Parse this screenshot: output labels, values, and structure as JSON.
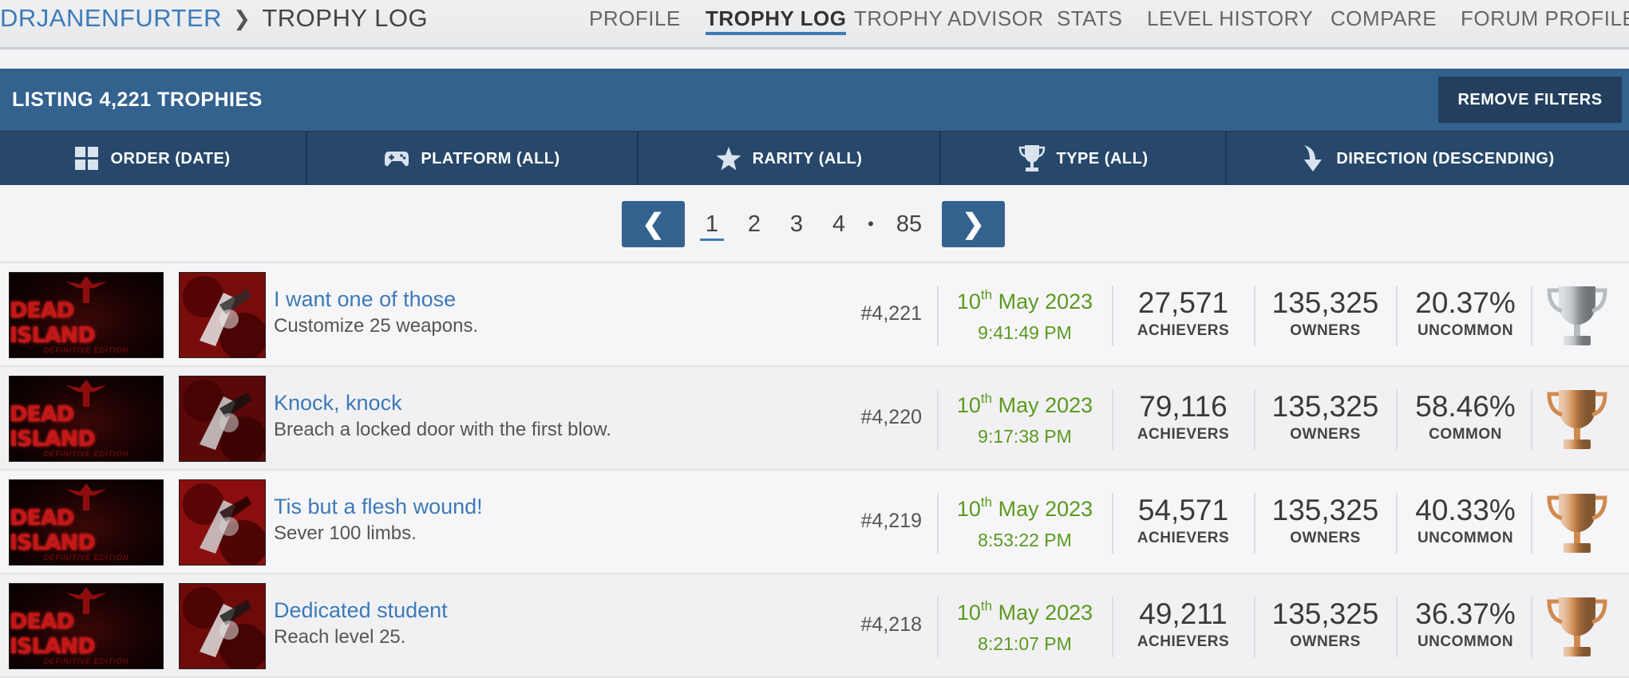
{
  "breadcrumb": {
    "user": "DRJANENFURTER",
    "separator": "❯",
    "page": "TROPHY LOG"
  },
  "nav": {
    "tabs": [
      {
        "label": "PROFILE",
        "active": false
      },
      {
        "label": "TROPHY LOG",
        "active": true
      },
      {
        "label": "TROPHY ADVISOR",
        "active": false
      },
      {
        "label": "STATS",
        "active": false
      },
      {
        "label": "LEVEL HISTORY",
        "active": false
      },
      {
        "label": "COMPARE",
        "active": false
      },
      {
        "label": "FORUM PROFILE",
        "active": false
      }
    ]
  },
  "listing": {
    "title": "LISTING 4,221 TROPHIES",
    "remove_filters": "REMOVE FILTERS"
  },
  "filters": [
    {
      "label": "ORDER (DATE)",
      "icon": "grid-icon"
    },
    {
      "label": "PLATFORM (ALL)",
      "icon": "gamepad-icon"
    },
    {
      "label": "RARITY (ALL)",
      "icon": "star-icon"
    },
    {
      "label": "TYPE (ALL)",
      "icon": "trophy-icon"
    },
    {
      "label": "DIRECTION (DESCENDING)",
      "icon": "arrow-down-icon"
    }
  ],
  "pagination": {
    "prev": "❮",
    "next": "❯",
    "pages": [
      "1",
      "2",
      "3",
      "4",
      "85"
    ],
    "current": "1",
    "ellipsis": "•"
  },
  "game": {
    "logo_text": "DEAD ISLAND",
    "logo_sub": "DEFINITIVE EDITION"
  },
  "stat_labels": {
    "achievers": "ACHIEVERS",
    "owners": "OWNERS"
  },
  "trophies": [
    {
      "name": "I want one of those",
      "description": "Customize 25 weapons.",
      "number": "#4,221",
      "day": "10",
      "day_suffix": "th",
      "month_year": "May 2023",
      "time": "9:41:49 PM",
      "achievers": "27,571",
      "owners": "135,325",
      "percent": "20.37%",
      "rarity": "UNCOMMON",
      "type": "silver",
      "type_color": "#b7bcc1"
    },
    {
      "name": "Knock, knock",
      "description": "Breach a locked door with the first blow.",
      "number": "#4,220",
      "day": "10",
      "day_suffix": "th",
      "month_year": "May 2023",
      "time": "9:17:38 PM",
      "achievers": "79,116",
      "owners": "135,325",
      "percent": "58.46%",
      "rarity": "COMMON",
      "type": "bronze",
      "type_color": "#d08a4f"
    },
    {
      "name": "Tis but a flesh wound!",
      "description": "Sever 100 limbs.",
      "number": "#4,219",
      "day": "10",
      "day_suffix": "th",
      "month_year": "May 2023",
      "time": "8:53:22 PM",
      "achievers": "54,571",
      "owners": "135,325",
      "percent": "40.33%",
      "rarity": "UNCOMMON",
      "type": "bronze",
      "type_color": "#d08a4f"
    },
    {
      "name": "Dedicated student",
      "description": "Reach level 25.",
      "number": "#4,218",
      "day": "10",
      "day_suffix": "th",
      "month_year": "May 2023",
      "time": "8:21:07 PM",
      "achievers": "49,211",
      "owners": "135,325",
      "percent": "36.37%",
      "rarity": "UNCOMMON",
      "type": "bronze",
      "type_color": "#d08a4f"
    }
  ]
}
